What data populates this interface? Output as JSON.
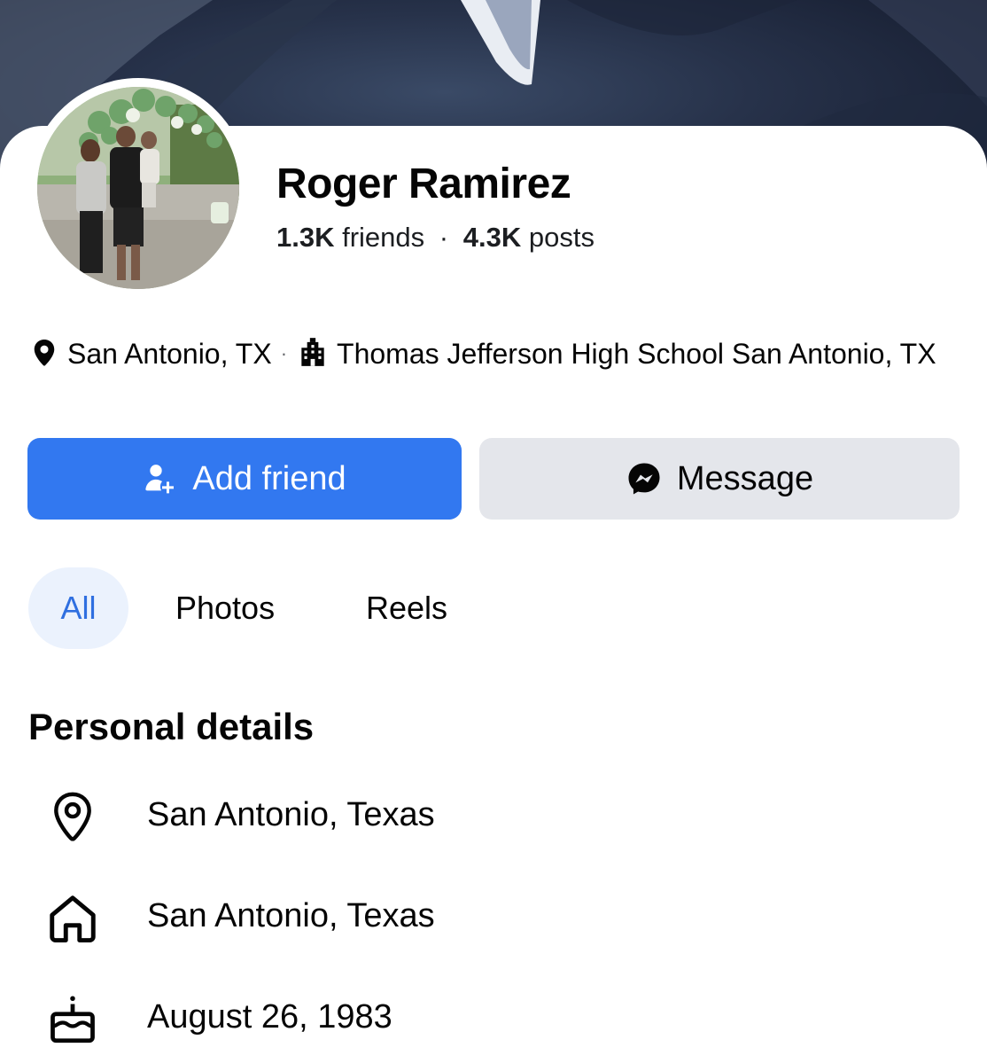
{
  "profile": {
    "name": "Roger Ramirez",
    "friends_count": "1.3K",
    "friends_label": "friends",
    "posts_count": "4.3K",
    "posts_label": "posts",
    "separator": "·"
  },
  "intro": {
    "location": "San Antonio, TX",
    "location_icon": "location-pin-icon",
    "separator": "·",
    "school": "Thomas Jefferson High School San Antonio, TX",
    "school_icon": "school-building-icon"
  },
  "actions": {
    "add_friend_label": "Add friend",
    "add_friend_icon": "person-add-icon",
    "message_label": "Message",
    "message_icon": "messenger-icon"
  },
  "tabs": [
    {
      "label": "All",
      "selected": true
    },
    {
      "label": "Photos",
      "selected": false
    },
    {
      "label": "Reels",
      "selected": false
    }
  ],
  "personal_details": {
    "title": "Personal details",
    "items": [
      {
        "icon": "location-pin-outline-icon",
        "text": "San Antonio, Texas"
      },
      {
        "icon": "home-icon",
        "text": "San Antonio, Texas"
      },
      {
        "icon": "birthday-cake-icon",
        "text": "August 26, 1983"
      }
    ]
  },
  "colors": {
    "accent": "#3278f0",
    "tab_selected_bg": "#ebf2fd",
    "tab_selected_text": "#2f6fe0",
    "secondary_button_bg": "#e4e6eb",
    "cover_dark": "#1a2236"
  }
}
